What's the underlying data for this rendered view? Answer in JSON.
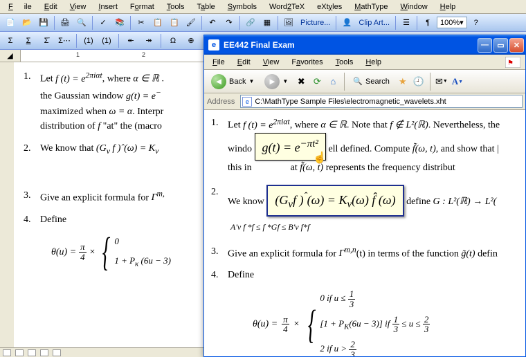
{
  "word_menu": {
    "file": "File",
    "edit": "Edit",
    "view": "View",
    "insert": "Insert",
    "format": "Format",
    "tools": "Tools",
    "table": "Table",
    "symbols": "Symbols",
    "word2tex": "Word2TeX",
    "extyles": "eXtyles",
    "mathtype": "MathType",
    "window": "Window",
    "help": "Help"
  },
  "word_toolbar": {
    "picture": "Picture...",
    "clipart": "Clip Art...",
    "zoom": "100%"
  },
  "word_doc": {
    "items": [
      {
        "num": "1.",
        "text_a": "Let ",
        "eq_a": "f (t) = e",
        "eq_a_sup": "2πiαt",
        "text_b": ", where ",
        "eq_b": "α ∈ ℝ",
        "line2_a": "the Gaussian window ",
        "eq_c": "g(t) = e",
        "eq_c_sup": "−",
        "line3_a": "maximized when ",
        "eq_d": "ω = α",
        "line3_b": ". Interpr",
        "line4_a": "distribution of ",
        "eq_e": "f",
        "line4_b": " \"at\" the (macro"
      },
      {
        "num": "2.",
        "text_a": "We know that ",
        "eq_a": "(G",
        "eq_a_sub": "ν",
        "eq_a2": " f )ˆ(ω) = K",
        "eq_a2_sub": "ν",
        "eq_center": "A'ν f* f ≤ f* Gf ≤ B'ν f* f"
      },
      {
        "num": "3.",
        "text_a": "Give an explicit formula for ",
        "eq_a": "Γ",
        "eq_a_sup": "m,"
      },
      {
        "num": "4.",
        "text_a": "Define"
      }
    ],
    "theta_eq": {
      "lhs": "θ(u) =",
      "frac_n": "π",
      "frac_d": "4",
      "times": "×",
      "row0": "0",
      "row1": "1 + P",
      "row1_sub": "κ",
      "row1b": " (6u − 3)"
    }
  },
  "ie": {
    "title": "EE442 Final Exam",
    "menu": {
      "file": "File",
      "edit": "Edit",
      "view": "View",
      "favorites": "Favorites",
      "tools": "Tools",
      "help": "Help"
    },
    "nav": {
      "back": "Back",
      "search": "Search"
    },
    "address_label": "Address",
    "address_value": "C:\\MathType Sample Files\\electromagnetic_wavelets.xht",
    "body": {
      "items": [
        {
          "num": "1.",
          "a": "Let ",
          "eq1": "f (t) = e",
          "eq1_sup": "2πiαt",
          "b": ", where ",
          "eq2": "α ∈ ℝ",
          "c": ". Note that ",
          "eq3": "f ∉ L²(ℝ)",
          "d": ". Nevertheless, the",
          "l2a": "windo",
          "tooltip": "g(t) = e",
          "tooltip_sup": "−πt²",
          "l2b": "ell defined. Compute ",
          "eq4": "f̃(ω, t)",
          "l2c": ", and show that |",
          "l3a": "this in",
          "l3b": "at ",
          "eq5": "f̃(ω, t)",
          "l3c": " represents the frequency distribut"
        },
        {
          "num": "2.",
          "a": "We know",
          "boxed": "(G",
          "boxed_sub": "ν",
          "boxed2": "f )ˆ(ω) = K",
          "boxed2_sub": "ν",
          "boxed3": "(ω) f̂ (ω)",
          "b": " define ",
          "eq1": "G : L²(ℝ) → L²(",
          "l2": "A'ν f *f ≤ f *Gf ≤ B'ν f*f"
        },
        {
          "num": "3.",
          "a": "Give an explicit formula for ",
          "eq1": "Γ",
          "eq1_sup": "m,n",
          "b": "(t) in terms of the function ",
          "eq2": "g̃(t)",
          "c": " defin"
        },
        {
          "num": "4.",
          "a": "Define"
        }
      ],
      "theta": {
        "lhs": "θ(u) =",
        "frac_n": "π",
        "frac_d": "4",
        "times": "×",
        "r0a": "0 if ",
        "r0b": "u ≤",
        "r0f_n": "1",
        "r0f_d": "3",
        "r1a": "[1 + P",
        "r1_sub": "K",
        "r1b": "(6u − 3)] if ",
        "r1f1_n": "1",
        "r1f1_d": "3",
        "r1c": " ≤ u ≤ ",
        "r1f2_n": "2",
        "r1f2_d": "3",
        "r2a": "2 if ",
        "r2b": "u >",
        "r2f_n": "2",
        "r2f_d": "3"
      }
    }
  }
}
